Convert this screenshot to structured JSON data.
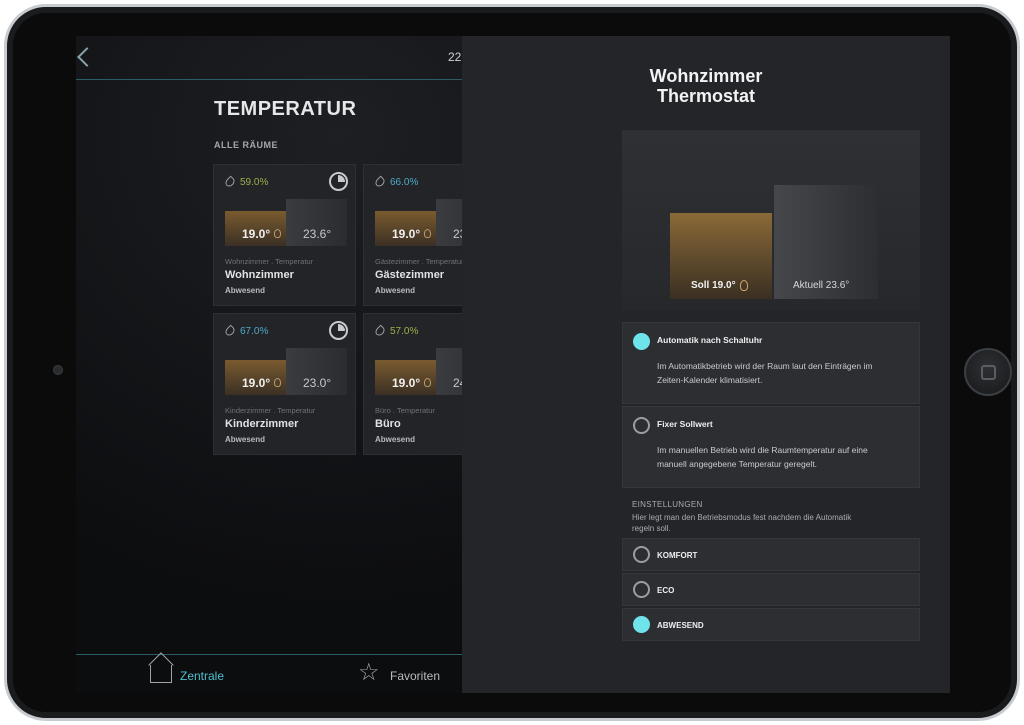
{
  "topbar": {
    "time": "22"
  },
  "page": {
    "title": "TEMPERATUR",
    "section": "ALLE RÄUME"
  },
  "rooms": [
    {
      "humidity": "59.0%",
      "humidity_color": "#9ab04a",
      "soll": "19.0°",
      "aktuell": "23.6°",
      "sub": "Wohnzimmer . Temperatur",
      "name": "Wohnzimmer",
      "status": "Abwesend",
      "timer": true
    },
    {
      "humidity": "66.0%",
      "humidity_color": "#4fa9c9",
      "soll": "19.0°",
      "aktuell": "23",
      "sub": "Gästezimmer . Temperatur",
      "name": "Gästezimmer",
      "status": "Abwesend",
      "timer": false
    },
    {
      "humidity": "67.0%",
      "humidity_color": "#4fa9c9",
      "soll": "19.0°",
      "aktuell": "23.0°",
      "sub": "Kinderzimmer . Temperatur",
      "name": "Kinderzimmer",
      "status": "Abwesend",
      "timer": true
    },
    {
      "humidity": "57.0%",
      "humidity_color": "#9ab04a",
      "soll": "19.0°",
      "aktuell": "24",
      "sub": "Büro . Temperatur",
      "name": "Büro",
      "status": "Abwesend",
      "timer": false
    }
  ],
  "bottom_nav": {
    "zentrale": "Zentrale",
    "favoriten": "Favoriten"
  },
  "panel": {
    "title_line1": "Wohnzimmer",
    "title_line2": "Thermostat",
    "soll_label": "Soll 19.0°",
    "aktuell_label": "Aktuell 23.6°",
    "modes": [
      {
        "title": "Automatik nach Schaltuhr",
        "desc": "Im Automatikbetrieb wird der Raum laut den Einträgen im Zeiten-Kalender klimatisiert.",
        "selected": true
      },
      {
        "title": "Fixer Sollwert",
        "desc": "Im manuellen Betrieb wird die Raumtemperatur auf eine manuell angegebene Temperatur geregelt.",
        "selected": false
      }
    ],
    "settings_heading": "EINSTELLUNGEN",
    "settings_desc": "Hier legt man den Betriebsmodus fest nachdem die Automatik regeln soll.",
    "options": [
      {
        "label": "KOMFORT",
        "selected": false
      },
      {
        "label": "ECO",
        "selected": false
      },
      {
        "label": "ABWESEND",
        "selected": true
      }
    ]
  },
  "colors": {
    "accent": "#6fe3ea",
    "soll_bar": "#8a6a38",
    "nav_active": "#4fbfcf"
  }
}
